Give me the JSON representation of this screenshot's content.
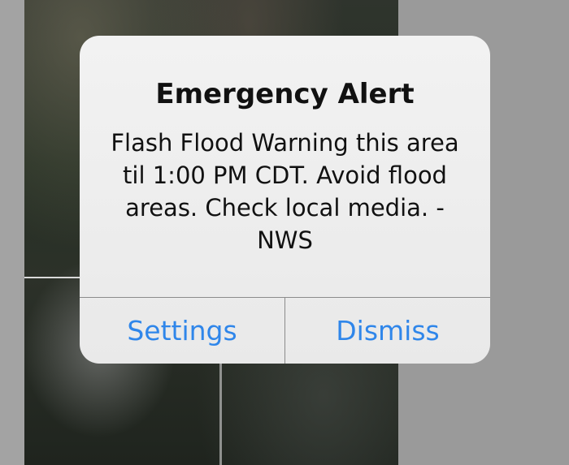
{
  "alert": {
    "title": "Emergency Alert",
    "message": "Flash Flood Warning this area til 1:00 PM CDT. Avoid flood areas. Check local media. -NWS",
    "buttons": {
      "settings": "Settings",
      "dismiss": "Dismiss"
    }
  },
  "colors": {
    "button_text": "#2f86ea",
    "alert_background": "#efefef",
    "divider": "#8b8b8b"
  }
}
